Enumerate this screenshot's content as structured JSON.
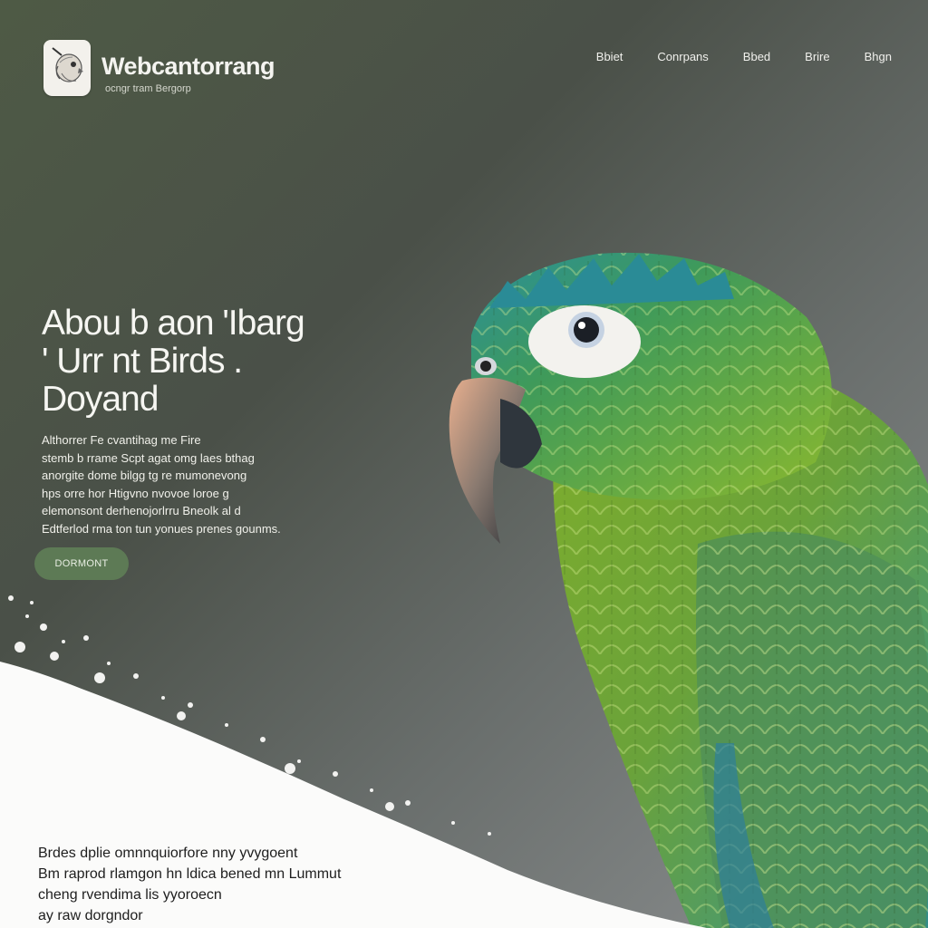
{
  "header": {
    "brand": "Webcantorrang",
    "tagline": "ocngr tram Bergorp",
    "logo_icon": "bird-head-icon"
  },
  "nav": {
    "items": [
      {
        "label": "Bbiet"
      },
      {
        "label": "Conrpans"
      },
      {
        "label": "Bbed"
      },
      {
        "label": "Brire"
      },
      {
        "label": "Bhgn"
      }
    ]
  },
  "hero": {
    "title_lines": [
      "Abou b aon 'Ibarg",
      "' Urr nt Birds .",
      "Doyand"
    ],
    "body_lines": [
      "Althorrer Fe cvantihag me Fire",
      "stemb b rrame Scpt agat omg laes bthag",
      "anorgite dome bilgg tg re mumonevong",
      "hps orre hor Htigvno nvovoe loroe g",
      "elemonsont derhenojorlrru Bneolk al d",
      "Edtferlod rma ton tun yonues prenes gounms."
    ],
    "cta_label": "DORMONT"
  },
  "caption": {
    "lines": [
      "Brdes dplie omnnquiorfore nny yvygoent",
      "Bm raprod rlamgon hn ldica bened mn Lummut",
      "cheng rvendima lis yyoroecn",
      "ay raw dorgndor"
    ]
  },
  "colors": {
    "background_dark": "#4e5a45",
    "background_light": "#8d9091",
    "accent_button": "#5d7a55",
    "text_light": "#f6f6f2",
    "text_dark": "#1e1e1e"
  }
}
